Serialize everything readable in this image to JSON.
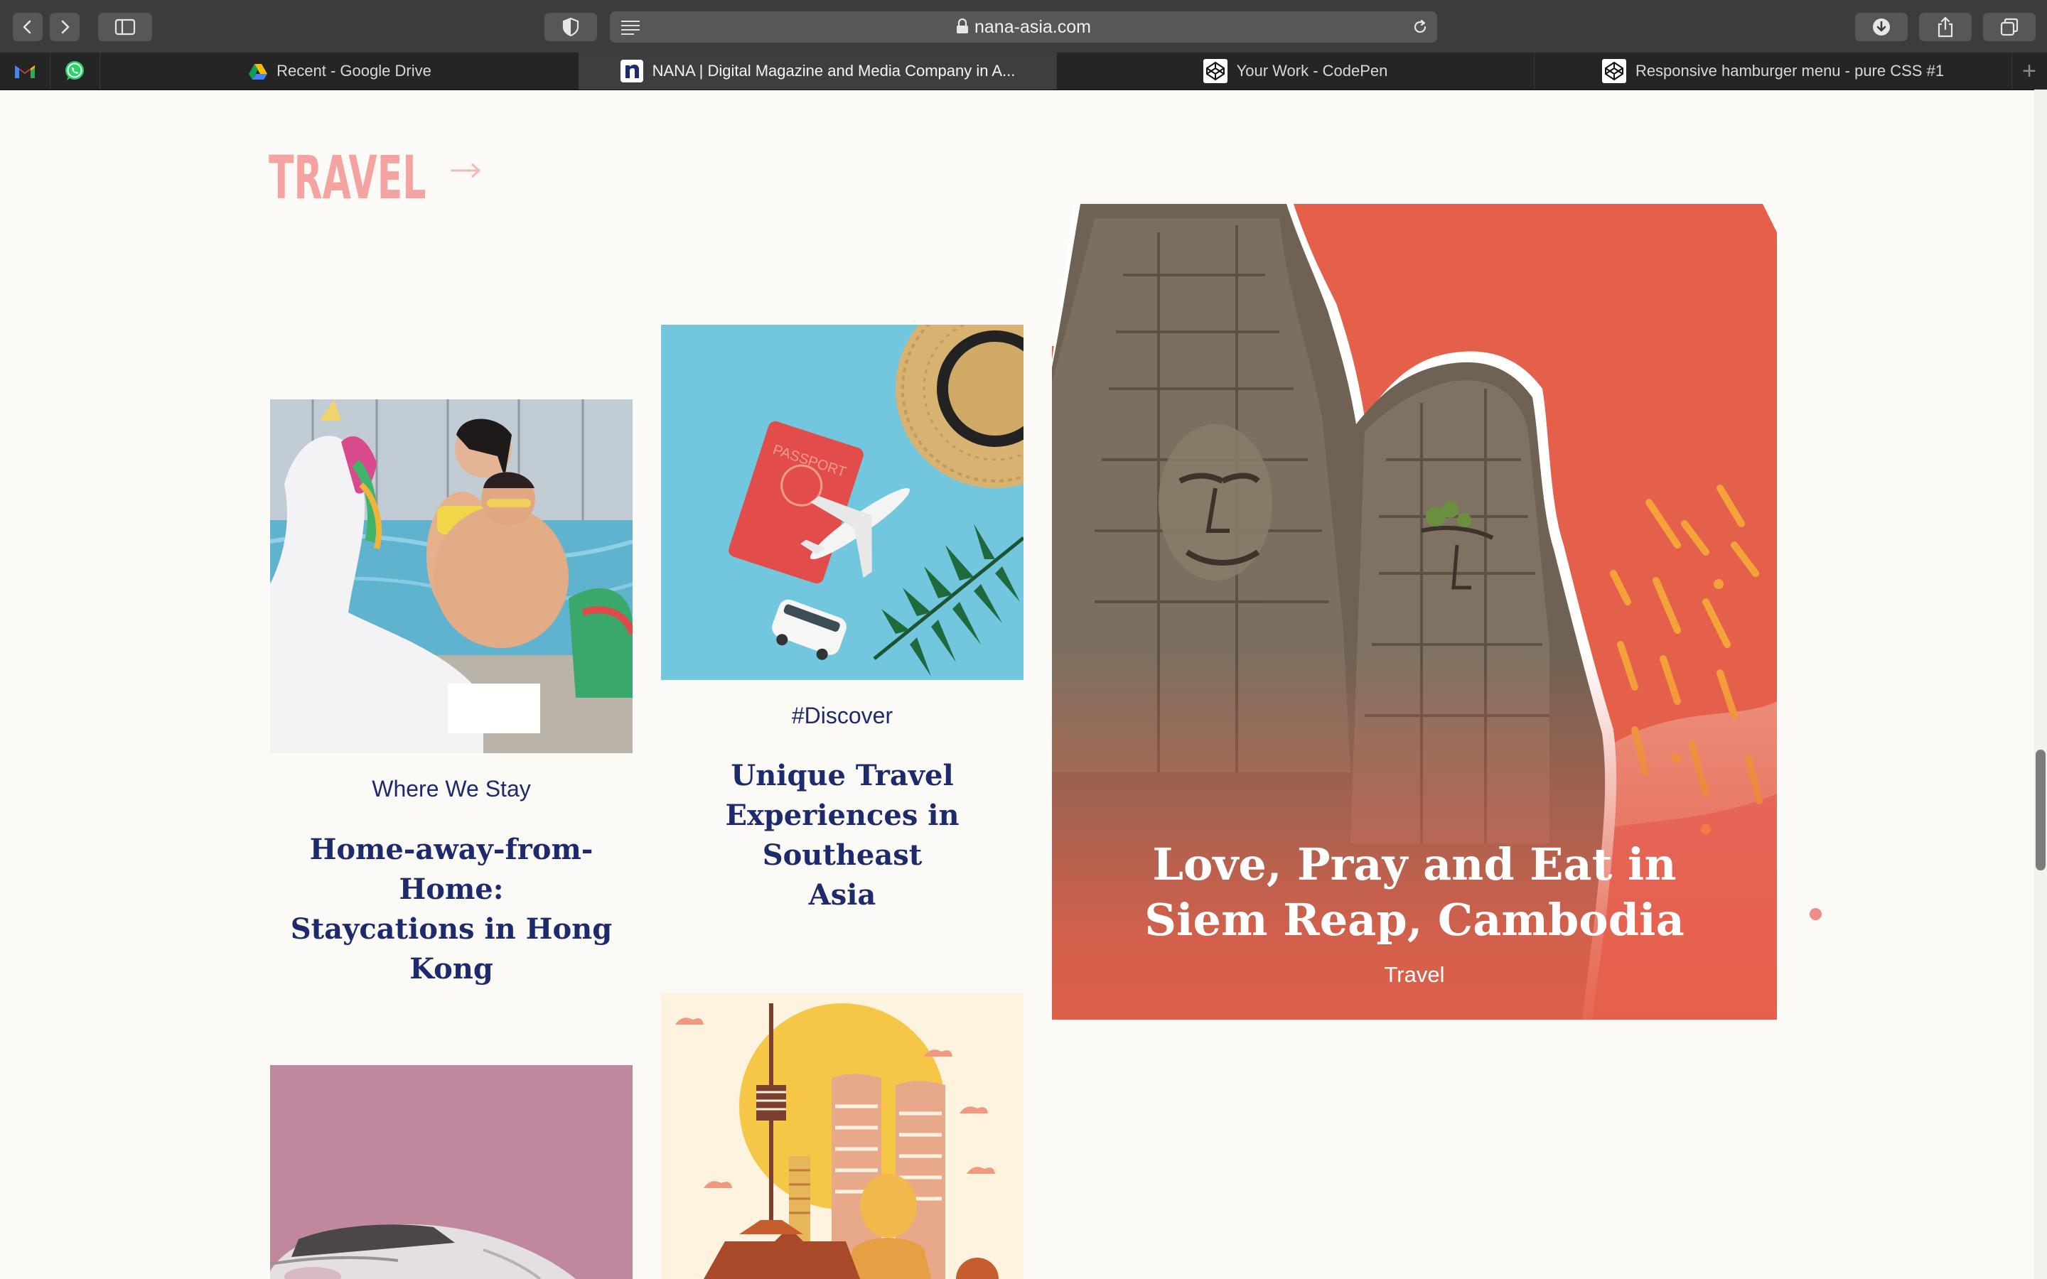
{
  "browser": {
    "url": "nana-asia.com",
    "tabs": [
      {
        "title": "Recent - Google Drive",
        "icon": "google-drive-icon",
        "active": false
      },
      {
        "title": "NANA | Digital Magazine and Media Company in A...",
        "icon": "nana-icon",
        "active": true
      },
      {
        "title": "Your Work - CodePen",
        "icon": "codepen-icon",
        "active": false
      },
      {
        "title": "Responsive hamburger menu - pure CSS #1",
        "icon": "codepen-icon",
        "active": false
      }
    ],
    "pinned": [
      "gmail-icon",
      "whatsapp-icon"
    ],
    "new_tab": "+"
  },
  "section": {
    "title": "TRAVEL",
    "arrow": "→"
  },
  "cards": [
    {
      "category": "Where We Stay",
      "title_lines": [
        "Home-away-from-Home:",
        "Staycations in Hong Kong"
      ]
    },
    {
      "category": "#Discover",
      "title_lines": [
        "Unique Travel",
        "Experiences in Southeast",
        "Asia"
      ]
    }
  ],
  "feature": {
    "title_lines": [
      "Love, Pray and Eat in",
      "Siem Reap, Cambodia"
    ],
    "category": "Travel"
  },
  "image_text": {
    "passport": "PASSPORT"
  },
  "colors": {
    "accent_pink": "#f4a3a0",
    "headline_navy": "#1d2a6b",
    "feature_orange": "#e4604a",
    "page_bg": "#fbfaf6"
  }
}
